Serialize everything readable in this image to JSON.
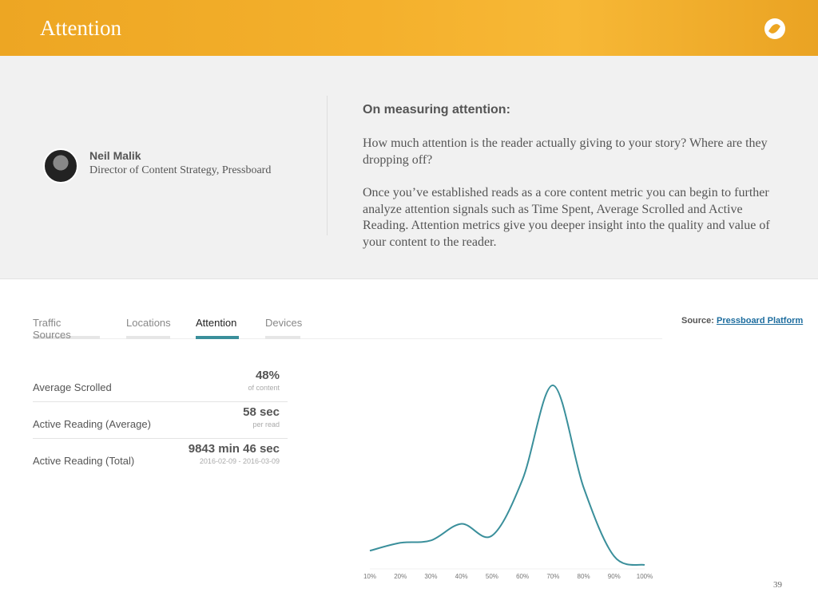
{
  "header": {
    "title": "Attention",
    "logo_icon": "pressboard-quill-icon"
  },
  "quote": {
    "author_name": "Neil Malik",
    "author_role": "Director of Content Strategy, Pressboard",
    "heading": "On measuring attention:",
    "paragraphs": [
      "How much attention is the reader actually giving to your story? Where are they dropping off?",
      "Once you’ve established reads as a core content metric you can begin to further analyze attention signals such as Time Spent, Average Scrolled and Active Reading. Attention metrics give you deeper insight into the quality and value of your content to the reader."
    ]
  },
  "tabs": [
    {
      "label": "Traffic Sources"
    },
    {
      "label": "Locations"
    },
    {
      "label": "Attention",
      "active": true
    },
    {
      "label": "Devices"
    }
  ],
  "source": {
    "label": "Source:",
    "link": "Pressboard Platform"
  },
  "stats": [
    {
      "label": "Average Scrolled",
      "value": "48%",
      "sub": "of content"
    },
    {
      "label": "Active Reading (Average)",
      "value": "58 sec",
      "sub": "per read"
    },
    {
      "label": "Active Reading (Total)",
      "value": "9843 min 46 sec",
      "sub": "2016-02-09 - 2016-03-09"
    }
  ],
  "chart_data": {
    "type": "line",
    "x": [
      "10%",
      "20%",
      "30%",
      "40%",
      "50%",
      "60%",
      "70%",
      "80%",
      "90%",
      "100%"
    ],
    "values": [
      23,
      33,
      36,
      57,
      42,
      113,
      232,
      103,
      16,
      5
    ],
    "ylim": [
      0,
      240
    ],
    "color": "#3a8f9b",
    "xlabel": "",
    "ylabel": "",
    "grid": false
  },
  "page_number": "39"
}
